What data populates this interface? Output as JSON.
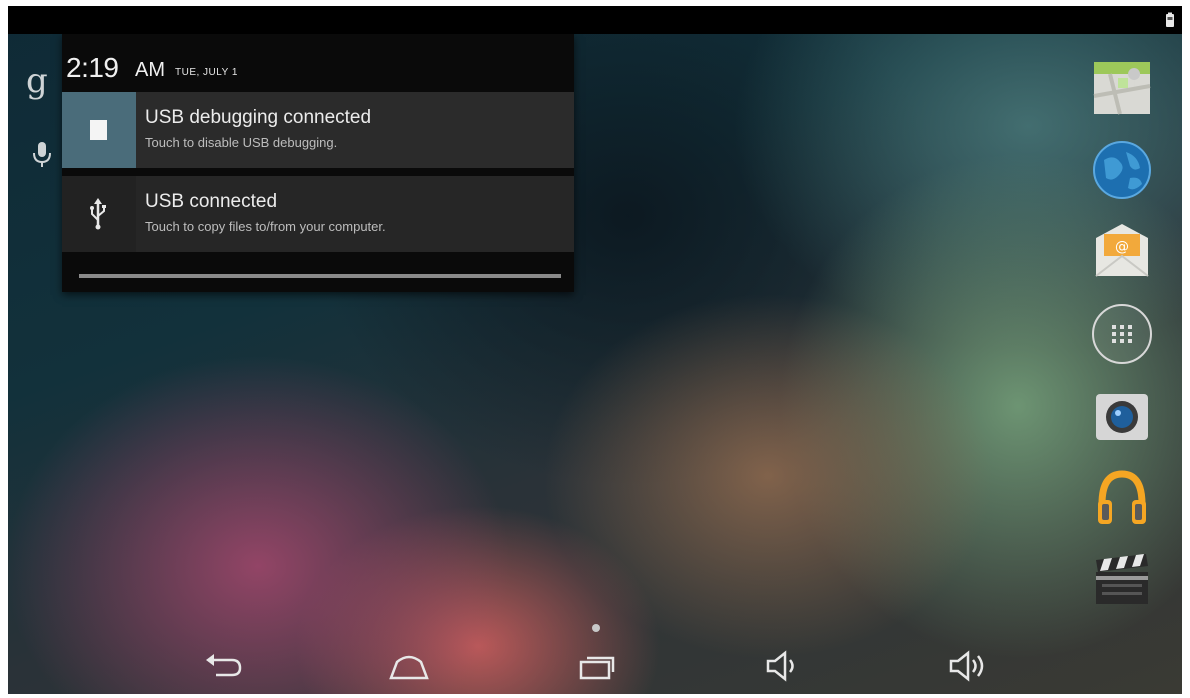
{
  "status_bar": {
    "battery_icon": "battery-icon"
  },
  "search": {
    "google_label": "g",
    "voice_icon": "mic-icon"
  },
  "notification_panel": {
    "time": "2:19",
    "ampm": "AM",
    "date": "TUE, JULY 1",
    "notifications": [
      {
        "icon": "bug-icon",
        "title": "USB debugging connected",
        "subtitle": "Touch to disable USB debugging."
      },
      {
        "icon": "usb-icon",
        "title": "USB connected",
        "subtitle": "Touch to copy files to/from your computer."
      }
    ]
  },
  "dock": {
    "apps": [
      {
        "icon": "maps-icon"
      },
      {
        "icon": "browser-globe-icon"
      },
      {
        "icon": "email-icon"
      },
      {
        "icon": "all-apps-icon"
      },
      {
        "icon": "camera-icon"
      },
      {
        "icon": "play-music-icon"
      },
      {
        "icon": "video-clapper-icon"
      }
    ]
  },
  "nav_bar": {
    "buttons": [
      {
        "icon": "back-icon"
      },
      {
        "icon": "home-icon"
      },
      {
        "icon": "recent-apps-icon"
      },
      {
        "icon": "volume-down-icon"
      },
      {
        "icon": "volume-up-icon"
      }
    ]
  },
  "colors": {
    "notification_bg": "#2b2b2b",
    "debug_icon_bg": "#4a6c7a",
    "status_bar": "#000000"
  }
}
